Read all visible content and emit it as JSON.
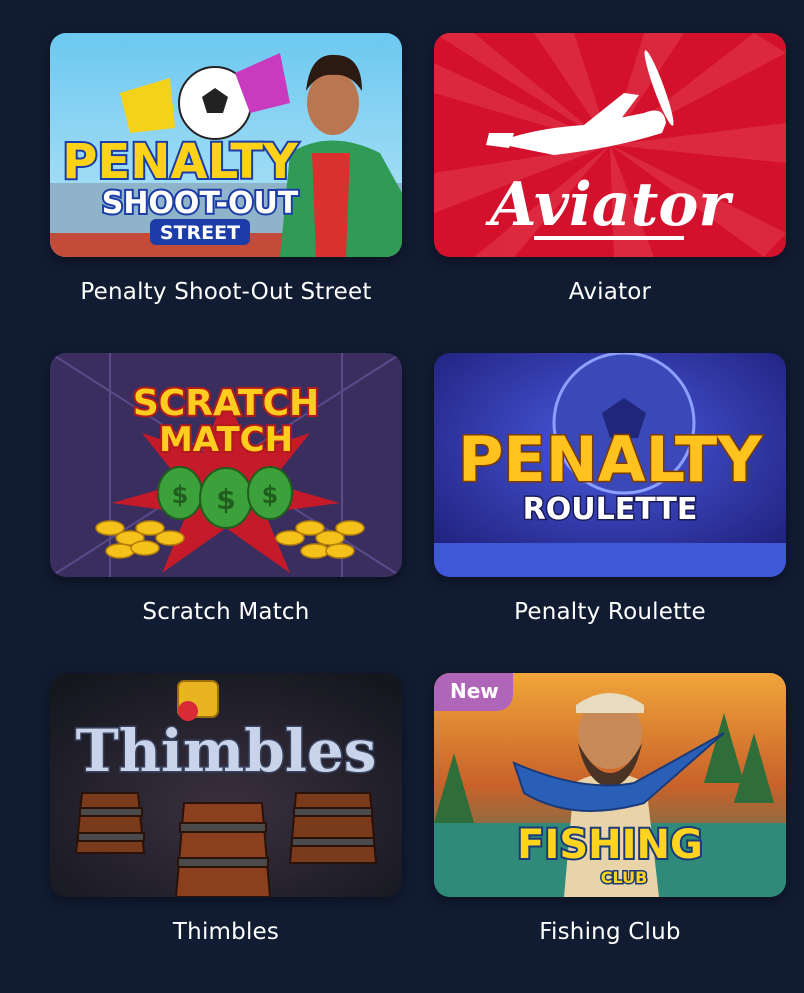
{
  "games": [
    {
      "title": "Penalty Shoot-Out Street",
      "art_title": "PENALTY",
      "art_sub": "SHOOT-OUT",
      "art_tag": "STREET",
      "bg": "#3fb8e8"
    },
    {
      "title": "Aviator",
      "art_title": "Aviator",
      "bg": "#d3112c"
    },
    {
      "title": "Scratch Match",
      "art_title": "SCRATCH",
      "art_sub": "MATCH",
      "bg": "#3a2e5e"
    },
    {
      "title": "Penalty Roulette",
      "art_title": "PENALTY",
      "art_sub": "ROULETTE",
      "bg": "#2a2f9e"
    },
    {
      "title": "Thimbles",
      "art_title": "Thimbles",
      "bg": "#1e2230"
    },
    {
      "title": "Fishing Club",
      "art_title": "FISHING",
      "art_sub": "CLUB",
      "badge": "New",
      "bg": "#3f8f6a"
    }
  ]
}
